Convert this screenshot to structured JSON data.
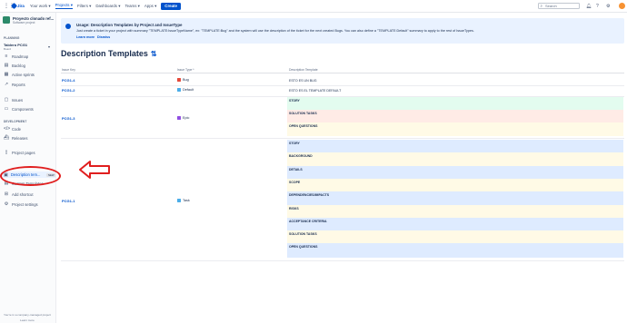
{
  "topnav": {
    "product": "Jira",
    "items": [
      "Your work",
      "Projects",
      "Filters",
      "Dashboards",
      "Teams",
      "Apps"
    ],
    "create_label": "Create",
    "search_placeholder": "Search"
  },
  "sidebar": {
    "project_name": "Proyecto clonado ref...",
    "project_type": "Software project",
    "planning_label": "PLANNING",
    "board_name": "Tablero PCG1",
    "board_sub": "Board",
    "items": [
      {
        "label": "Roadmap",
        "icon": "roadmap-icon"
      },
      {
        "label": "Backlog",
        "icon": "backlog-icon"
      },
      {
        "label": "Active sprints",
        "icon": "sprint-icon"
      },
      {
        "label": "Reports",
        "icon": "reports-icon"
      },
      {
        "label": "Issues",
        "icon": "issues-icon"
      },
      {
        "label": "Components",
        "icon": "components-icon"
      }
    ],
    "development_label": "DEVELOPMENT",
    "dev_items": [
      {
        "label": "Code",
        "icon": "code-icon"
      },
      {
        "label": "Releases",
        "icon": "releases-icon"
      },
      {
        "label": "Project pages",
        "icon": "pages-icon"
      },
      {
        "label": "Description tem...",
        "icon": "description-templates-icon",
        "badge": "NEW"
      },
      {
        "label": "Custom Templates",
        "icon": "custom-templates-icon"
      },
      {
        "label": "Add shortcut",
        "icon": "add-shortcut-icon"
      },
      {
        "label": "Project settings",
        "icon": "gear-icon"
      }
    ],
    "footer_text": "You're in a company-managed project",
    "footer_link": "Learn more"
  },
  "banner": {
    "title": "Usage: Description Templates by Project and IssueType",
    "body": "Just create a ticket in your project with summary \"TEMPLATE:IssueTypeName\", ex: \"TEMPLATE:Bug\" and the system will use the description of the ticket for the next created Bugs. You can also define a \"TEMPLATE:Default\" summary to apply to the rest of IssueTypes.",
    "learn_more": "Learn more",
    "dismiss": "Dismiss"
  },
  "page_title": "Description Templates",
  "table": {
    "headers": [
      "Issue Key",
      "Issue Type *",
      "Description Template"
    ],
    "rows": [
      {
        "key": "PCG1-4",
        "type": "Bug",
        "type_color": "#e5493a",
        "template": "ESTO ES UN BUG"
      },
      {
        "key": "PCG1-2",
        "type": "Default",
        "type_color": "#4bade8",
        "template": "ESTO ES EL TEMPLATE DEFAULT"
      },
      {
        "key": "PCG1-3",
        "type": "Epic",
        "type_color": "#904ee2",
        "sections": [
          "STORY",
          "SOLUTION TASKS",
          "OPEN QUESTIONS"
        ]
      },
      {
        "key": "PCG1-1",
        "type": "Task",
        "type_color": "#4bade8",
        "sections": [
          "STORY",
          "BACKGROUND",
          "DETAILS",
          "SCOPE",
          "DEPENDENCIES/IMPACTS",
          "RISKS",
          "ACCEPTANCE CRITERIA",
          "SOLUTION TASKS",
          "OPEN QUESTIONS"
        ]
      }
    ]
  },
  "colors": {
    "accent": "#0052cc",
    "block_green": "#e3fcef",
    "block_red": "#ffebe6",
    "block_yellow": "#fffae6",
    "block_blue": "#deebff",
    "annotation": "#e01e1e"
  }
}
